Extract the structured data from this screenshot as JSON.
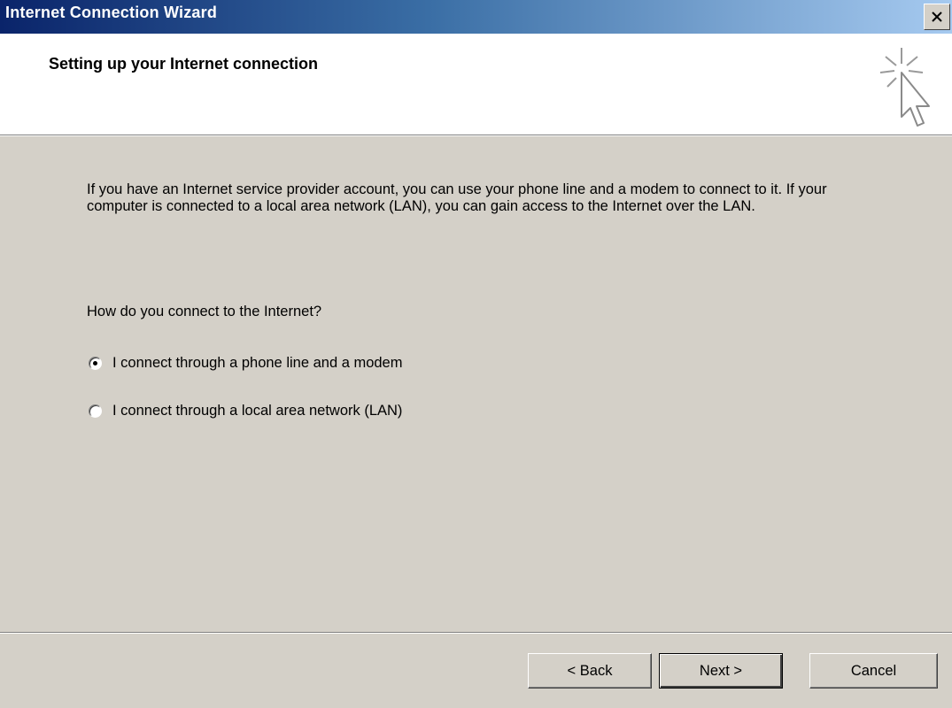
{
  "window": {
    "title": "Internet Connection Wizard"
  },
  "header": {
    "title": "Setting up your Internet connection",
    "icon": "wizard-cursor-sparkle-icon"
  },
  "main": {
    "description": "If you have an Internet service provider account, you can use your phone line and a modem to connect to it. If your computer is connected to a local area network (LAN), you can gain access to the Internet over the LAN.",
    "question": "How do you connect to the Internet?",
    "options": [
      {
        "label": "I connect through a phone line and a modem",
        "selected": true
      },
      {
        "label": "I connect through a local area network (LAN)",
        "selected": false
      }
    ]
  },
  "footer": {
    "back_label": "< Back",
    "next_label": "Next >",
    "cancel_label": "Cancel"
  },
  "colors": {
    "titlebar_start": "#0a246a",
    "titlebar_end": "#a6caf0",
    "face": "#d4d0c8",
    "header_bg": "#ffffff"
  }
}
